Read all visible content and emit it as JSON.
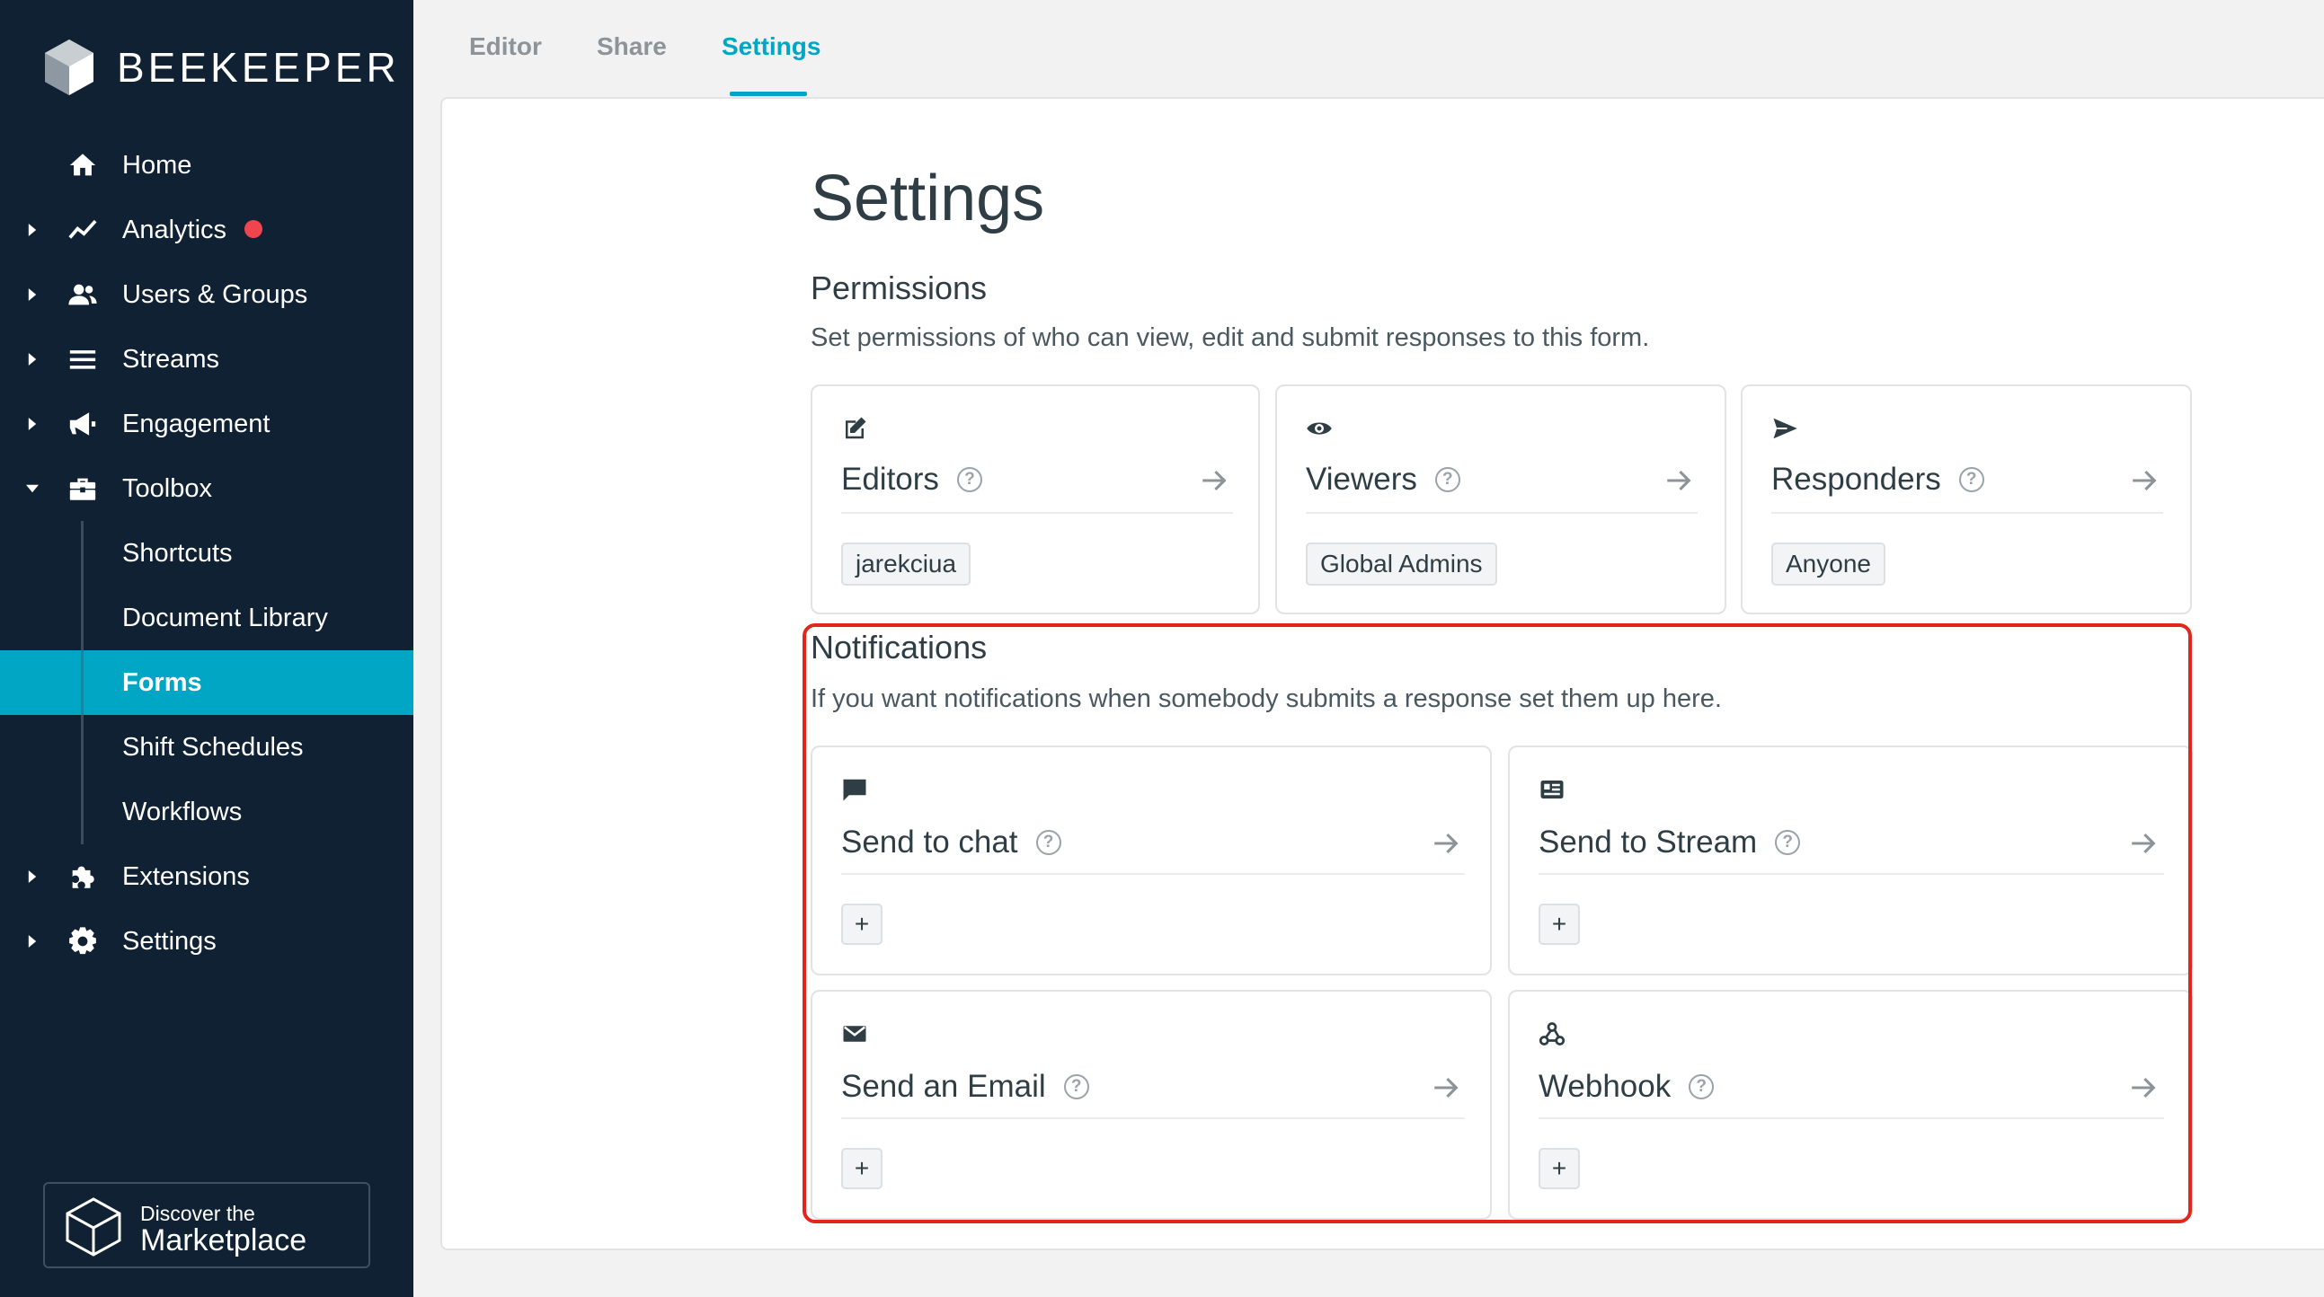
{
  "sidebar": {
    "brand": "BEEKEEPER",
    "items": [
      {
        "label": "Home"
      },
      {
        "label": "Analytics"
      },
      {
        "label": "Users & Groups"
      },
      {
        "label": "Streams"
      },
      {
        "label": "Engagement"
      },
      {
        "label": "Toolbox"
      }
    ],
    "toolbox_items": [
      {
        "label": "Shortcuts"
      },
      {
        "label": "Document Library"
      },
      {
        "label": "Forms"
      },
      {
        "label": "Shift Schedules"
      },
      {
        "label": "Workflows"
      }
    ],
    "bottom_items": [
      {
        "label": "Extensions"
      },
      {
        "label": "Settings"
      }
    ],
    "marketplace": {
      "line1": "Discover the",
      "line2": "Marketplace"
    }
  },
  "tabs": [
    {
      "label": "Editor"
    },
    {
      "label": "Share"
    },
    {
      "label": "Settings"
    }
  ],
  "page": {
    "title": "Settings",
    "permissions": {
      "title": "Permissions",
      "description": "Set permissions of who can view, edit and submit responses to this form.",
      "cards": [
        {
          "title": "Editors",
          "icon": "edit-icon",
          "chip": "jarekciua"
        },
        {
          "title": "Viewers",
          "icon": "eye-icon",
          "chip": "Global Admins"
        },
        {
          "title": "Responders",
          "icon": "send-icon",
          "chip": "Anyone"
        }
      ]
    },
    "notifications": {
      "title": "Notifications",
      "description": "If you want notifications when somebody submits a response set them up here.",
      "cards": [
        {
          "title": "Send to chat",
          "icon": "chat-icon"
        },
        {
          "title": "Send to Stream",
          "icon": "stream-icon"
        },
        {
          "title": "Send an Email",
          "icon": "mail-icon"
        },
        {
          "title": "Webhook",
          "icon": "webhook-icon"
        }
      ],
      "add_label": "+"
    },
    "help_glyph": "?"
  },
  "colors": {
    "sidebar_bg": "#0f2133",
    "accent": "#00a6c4",
    "badge": "#f0454f",
    "highlight": "#e3261c"
  }
}
